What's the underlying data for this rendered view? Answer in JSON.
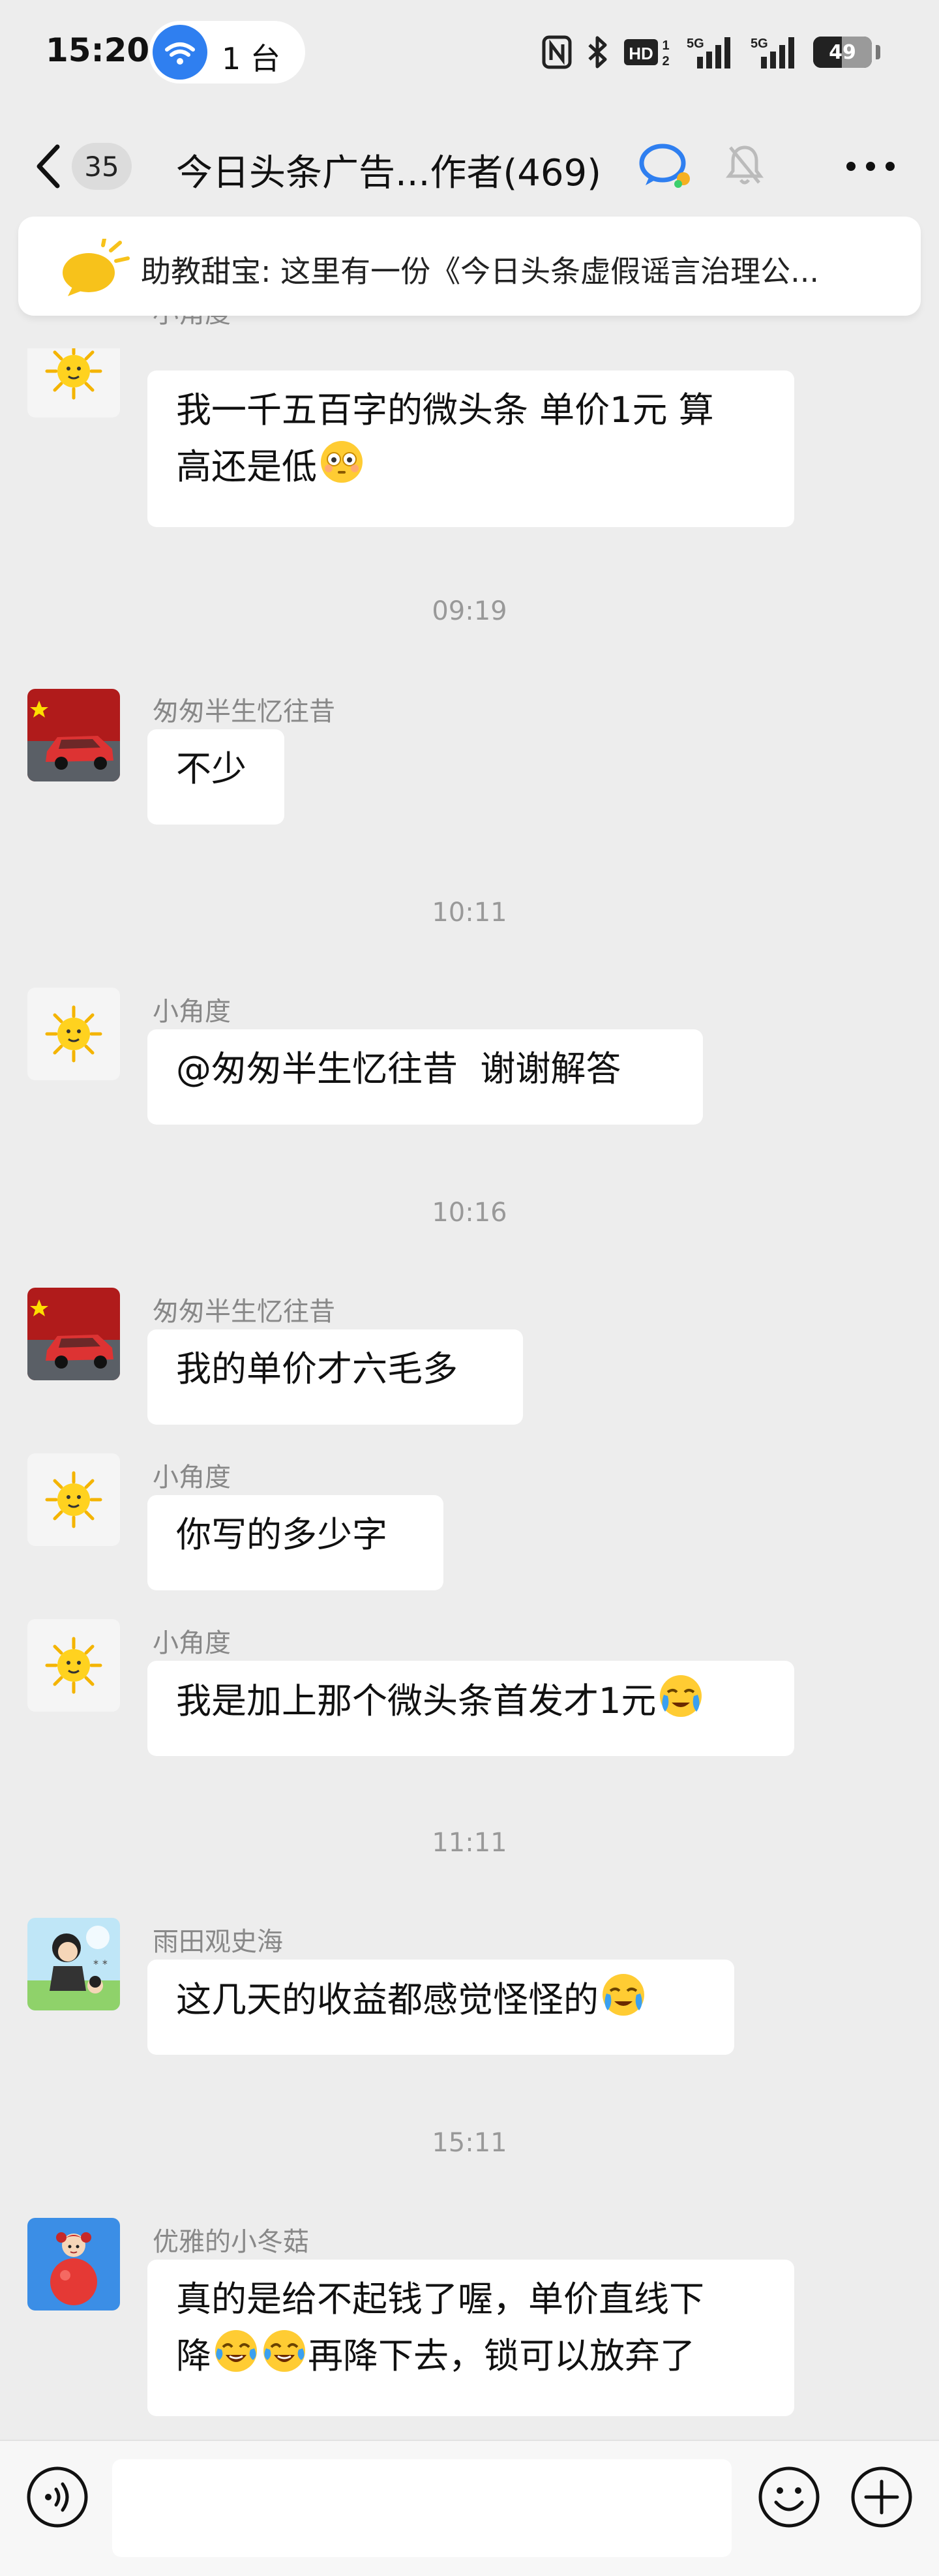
{
  "status_bar": {
    "time": "15:20",
    "hotspot_count": "1 台",
    "battery": "49",
    "battery_level": 0.49,
    "icons": [
      "nfc-icon",
      "bluetooth-icon",
      "hd-icon",
      "signal-5g-icon",
      "signal-5g-icon",
      "battery-icon"
    ]
  },
  "header": {
    "unread_count": "35",
    "title": "今日头条广告...作者(469)",
    "icons": [
      "back-icon",
      "chat-group-icon",
      "mute-bell-icon",
      "more-icon"
    ]
  },
  "announcement": {
    "text": "助教甜宝: 这里有一份《今日头条虚假谣言治理公...",
    "icon": "speech-bubble-icon"
  },
  "messages": [
    {
      "sender": "小角度",
      "avatar": "sun-avatar",
      "text": "我一千五百字的微头条 单价1元 算",
      "text2": "高还是低",
      "emoji": "flushed-emoji"
    },
    {
      "timestamp": "09:19"
    },
    {
      "sender": "匆匆半生忆往昔",
      "avatar": "car-flag-avatar",
      "text": "不少"
    },
    {
      "timestamp": "10:11"
    },
    {
      "sender": "小角度",
      "avatar": "sun-avatar",
      "text": "@匆匆半生忆往昔  谢谢解答"
    },
    {
      "timestamp": "10:16"
    },
    {
      "sender": "匆匆半生忆往昔",
      "avatar": "car-flag-avatar",
      "text": "我的单价才六毛多"
    },
    {
      "sender": "小角度",
      "avatar": "sun-avatar",
      "text": "你写的多少字"
    },
    {
      "sender": "小角度",
      "avatar": "sun-avatar",
      "text": "我是加上那个微头条首发才1元",
      "emoji": "crying-emoji"
    },
    {
      "timestamp": "11:11"
    },
    {
      "sender": "雨田观史海",
      "avatar": "cartoon-avatar",
      "text": "这几天的收益都感觉怪怪的",
      "emoji": "crying-emoji"
    },
    {
      "timestamp": "15:11"
    },
    {
      "sender": "优雅的小冬菇",
      "avatar": "apple-girl-avatar",
      "text": "真的是给不起钱了喔，单价直线下",
      "text2a": "降",
      "text2b": "再降下去，锁可以放弃了",
      "emoji": "tears-of-joy-emoji"
    }
  ],
  "input_bar": {
    "placeholder": "",
    "icons": [
      "voice-icon",
      "emoji-icon",
      "plus-icon"
    ]
  },
  "colors": {
    "background": "#ededed",
    "bubble": "#ffffff",
    "sender_text": "#888888",
    "timestamp_text": "#999999",
    "accent_blue": "#2f7ff0"
  }
}
